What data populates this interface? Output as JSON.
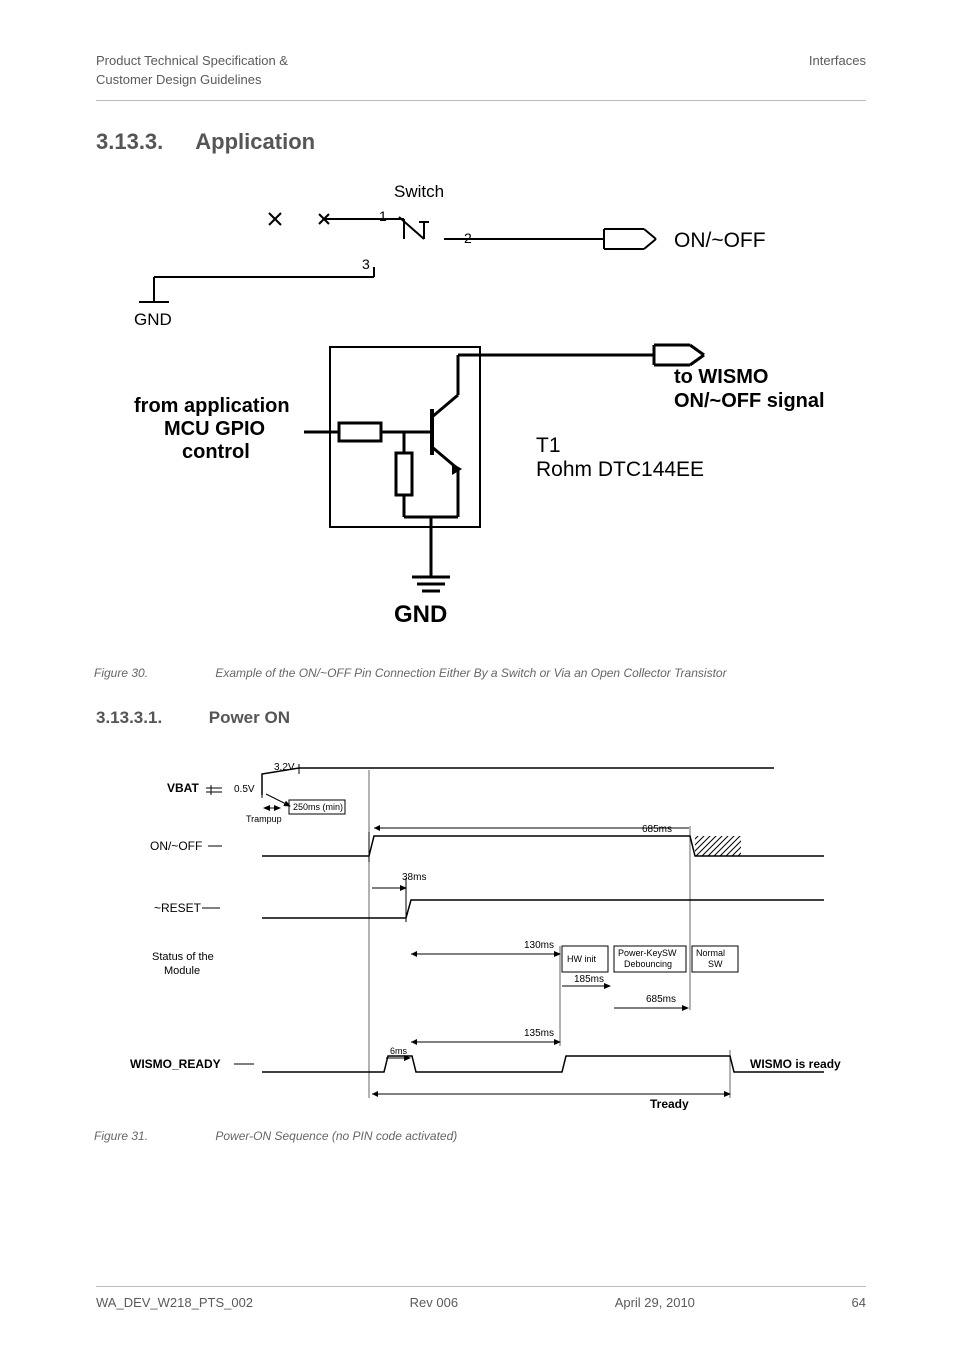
{
  "header": {
    "left_line1": "Product Technical Specification &",
    "left_line2": "Customer Design Guidelines",
    "right": "Interfaces"
  },
  "sections": {
    "h2_num": "3.13.3.",
    "h2_title": "Application",
    "h3_num": "3.13.3.1.",
    "h3_title": "Power ON"
  },
  "figure30": {
    "fignum": "Figure 30.",
    "caption": "Example of the ON/~OFF Pin Connection Either By a Switch or Via an Open Collector Transistor",
    "labels": {
      "switch": "Switch",
      "pin1": "1",
      "pin2": "2",
      "pin3": "3",
      "on_off": "ON/~OFF",
      "gnd_top": "GND",
      "from_app_l1": "from application",
      "from_app_l2": "MCU GPIO",
      "from_app_l3": "control",
      "to_wismo_l1": "to  WISMO",
      "to_wismo_l2": "ON/~OFF signal",
      "t1": "T1",
      "rohm": "Rohm DTC144EE",
      "gnd_bottom": "GND"
    }
  },
  "figure31": {
    "fignum": "Figure 31.",
    "caption": "Power-ON Sequence (no PIN code activated)",
    "labels": {
      "vbat": "VBAT",
      "v32": "3.2V",
      "v05": "0.5V",
      "trampup": "Trampup",
      "t250": "250ms (min)",
      "on_off": "ON/~OFF",
      "t685": "685ms",
      "t38": "38ms",
      "reset": "~RESET",
      "status_l1": "Status of the",
      "status_l2": "Module",
      "t130": "130ms",
      "hwinit": "HW init",
      "pksw_l1": "Power-KeySW",
      "pksw_l2": "Debouncing",
      "normal_l1": "Normal",
      "normal_l2": "SW",
      "t185": "185ms",
      "t685b": "685ms",
      "t135": "135ms",
      "t6": "6ms",
      "wismo_ready_label": "WISMO_READY",
      "wismo_ready_note": "WISMO is ready",
      "tready": "Tready"
    }
  },
  "footer": {
    "doc": "WA_DEV_W218_PTS_002",
    "rev": "Rev 006",
    "date": "April 29, 2010",
    "page": "64"
  }
}
